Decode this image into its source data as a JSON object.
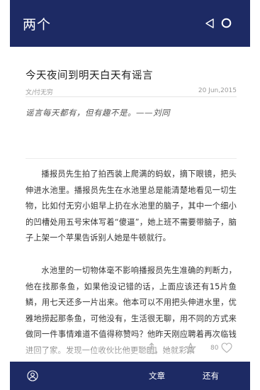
{
  "header": {
    "title": "两个",
    "back_icon": "back-triangle-icon",
    "menu_icon": "circle-icon",
    "background": "#1d2a64"
  },
  "article": {
    "title": "今天夜间到明天白天有谣言",
    "author": "文/付无穷",
    "date": "20 Jun,2015",
    "quote": "谣言每天都有，但有趣不是。——刘同",
    "paragraphs": [
      "播报员先生拍了拍西装上爬满的蚂蚁，摘下眼镜，把头伸进水池里。播报员先生在水池里总是能清楚地看见一切生物，比如付无穷小姐早上扔在水池里的脑子，其中一个细小的凹槽处用五号宋体写着“傻逼”，她上班不需要带脑子，脑子上架一个苹果告诉别人她是牛顿就行。",
      "水池里的一切物体毫不影响播报员先生准确的判断力，他在找那条鱼，如果他没记错的话，上面应该还有15片鱼鳞，用七天还多一片出来。他本可以不用把头伸进水里，优雅地捞起那条鱼，可他没有，生活很无聊，用不同的方式来做同一件事情难道不值得称赞吗？他昨天刚应聘着再次临钱进回了家。发现一位收伙比他更聪明，她就彩票"
    ]
  },
  "actions": {
    "like_count": "80"
  },
  "bottom_nav": {
    "tabs": [
      {
        "label": "文章"
      },
      {
        "label": "还有"
      }
    ]
  }
}
